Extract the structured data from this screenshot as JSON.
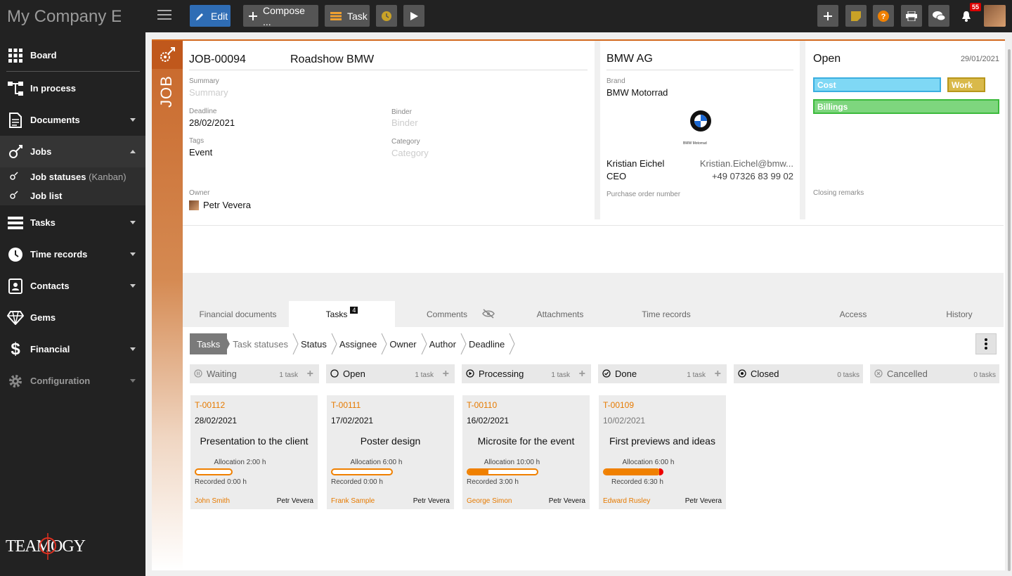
{
  "app": {
    "brand": "My Company El"
  },
  "toolbar": {
    "edit_label": "Edit",
    "compose_label": "Compose ...",
    "task_label": "Task",
    "notifications_count": "55"
  },
  "sidebar": {
    "items": [
      {
        "label": "Board"
      },
      {
        "label": "In process"
      },
      {
        "label": "Documents"
      },
      {
        "label": "Jobs"
      },
      {
        "label": "Tasks"
      },
      {
        "label": "Time records"
      },
      {
        "label": "Contacts"
      },
      {
        "label": "Gems"
      },
      {
        "label": "Financial"
      },
      {
        "label": "Configuration"
      }
    ],
    "sub": [
      {
        "label": "Job statuses",
        "suffix": "(Kanban)"
      },
      {
        "label": "Job list"
      }
    ],
    "logo_text": "TEAMOGY"
  },
  "job": {
    "strip_label": "JOB",
    "number": "JOB-00094",
    "title": "Roadshow BMW",
    "summary_label": "Summary",
    "summary_placeholder": "Summary",
    "deadline_label": "Deadline",
    "deadline": "28/02/2021",
    "binder_label": "Binder",
    "binder_placeholder": "Binder",
    "tags_label": "Tags",
    "tags": "Event",
    "category_label": "Category",
    "category_placeholder": "Category",
    "owner_label": "Owner",
    "owner": "Petr Vevera"
  },
  "client": {
    "name": "BMW AG",
    "brand_label": "Brand",
    "brand": "BMW Motorrad",
    "logo_caption": "BMW Motorrad",
    "contact_name": "Kristian Eichel",
    "contact_email": "Kristian.Eichel@bmw...",
    "contact_role": "CEO",
    "contact_phone": "+49 07326 83 99 02",
    "po_label": "Purchase order number"
  },
  "status": {
    "state": "Open",
    "date": "29/01/2021",
    "tags": [
      "Cost",
      "Work",
      "Billings"
    ],
    "closing_label": "Closing remarks"
  },
  "tabs": [
    {
      "label": "Financial documents"
    },
    {
      "label": "Tasks",
      "count": "4"
    },
    {
      "label": "Comments"
    },
    {
      "label": "Attachments"
    },
    {
      "label": "Time records"
    },
    {
      "label": "Access"
    },
    {
      "label": "History"
    }
  ],
  "crumbs": [
    "Tasks",
    "Task statuses",
    "Status",
    "Assignee",
    "Owner",
    "Author",
    "Deadline"
  ],
  "columns": [
    {
      "name": "Waiting",
      "count": "1 task"
    },
    {
      "name": "Open",
      "count": "1 task"
    },
    {
      "name": "Processing",
      "count": "1 task"
    },
    {
      "name": "Done",
      "count": "1 task"
    },
    {
      "name": "Closed",
      "count": "0 tasks"
    },
    {
      "name": "Cancelled",
      "count": "0 tasks"
    }
  ],
  "cards": [
    {
      "id": "T-00112",
      "date": "28/02/2021",
      "title": "Presentation to the client",
      "allocation": "Allocation 2:00 h",
      "recorded": "Recorded 0:00 h",
      "progress": 0,
      "assignee": "John Smith",
      "owner": "Petr Vevera"
    },
    {
      "id": "T-00111",
      "date": "17/02/2021",
      "title": "Poster design",
      "allocation": "Allocation 6:00 h",
      "recorded": "Recorded 0:00 h",
      "progress": 0,
      "assignee": "Frank Sample",
      "owner": "Petr Vevera"
    },
    {
      "id": "T-00110",
      "date": "16/02/2021",
      "title": "Microsite for the event",
      "allocation": "Allocation 10:00 h",
      "recorded": "Recorded 3:00 h",
      "progress": 0.3,
      "assignee": "George Simon",
      "owner": "Petr Vevera"
    },
    {
      "id": "T-00109",
      "date": "10/02/2021",
      "title": "First previews and ideas",
      "allocation": "Allocation 6:00 h",
      "recorded": "Recorded 6:30 h",
      "progress": 1.08,
      "assignee": "Edward Rusley",
      "owner": "Petr Vevera"
    }
  ],
  "colors": {
    "accent": "#e67a00",
    "cost_tag": "#7fd8f5",
    "work_tag": "#c9a227",
    "billings_tag": "#7ed67e",
    "edit_button": "#2f6db5"
  }
}
